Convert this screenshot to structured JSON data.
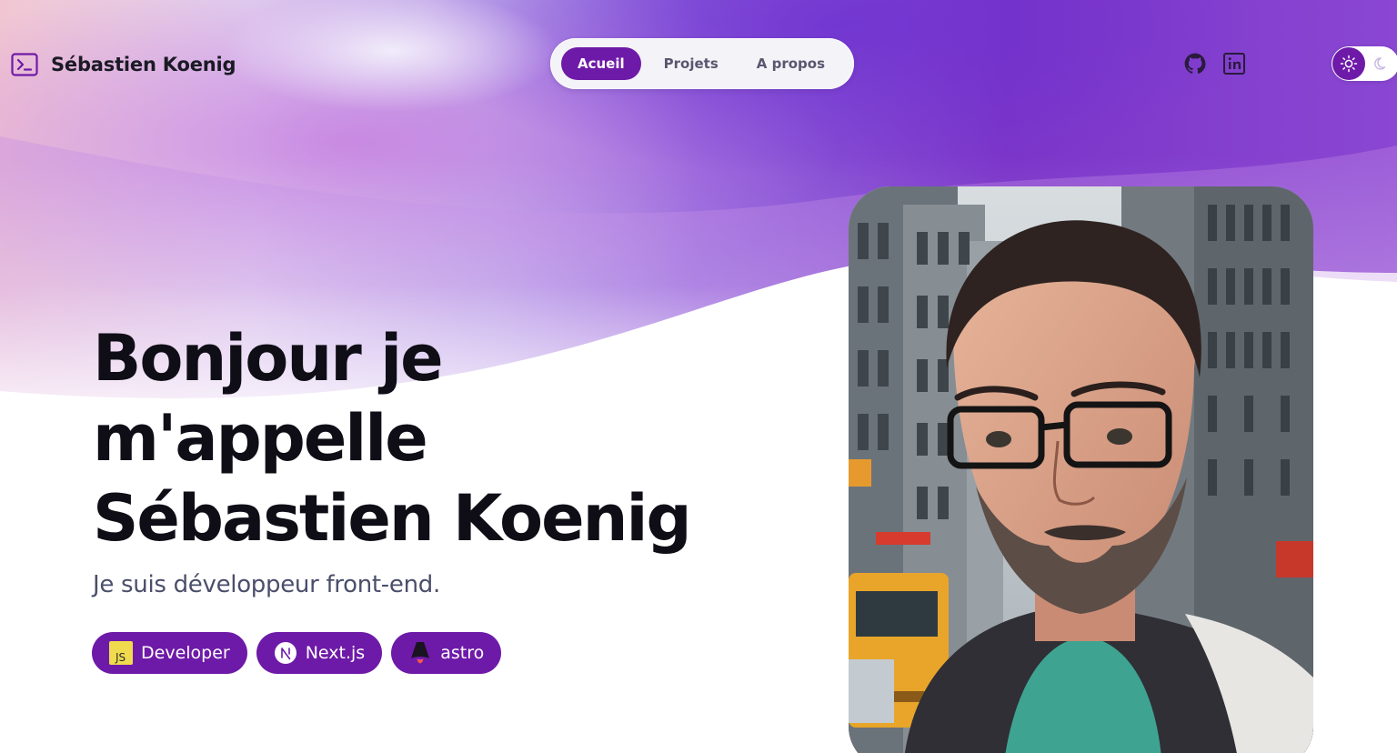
{
  "header": {
    "brand_name": "Sébastien Koenig",
    "nav": [
      {
        "label": "Acueil",
        "active": true
      },
      {
        "label": "Projets",
        "active": false
      },
      {
        "label": "A propos",
        "active": false
      }
    ],
    "social_icons": [
      "github-icon",
      "linkedin-icon"
    ],
    "theme_toggle": {
      "icons": [
        "sun-icon",
        "moon-icon"
      ],
      "selected": "light"
    }
  },
  "hero": {
    "title_lines": [
      "Bonjour je",
      "m'appelle",
      "Sébastien Koenig"
    ],
    "subtitle": "Je suis développeur front-end.",
    "badges": [
      {
        "label": "Developer",
        "icon": "javascript-icon"
      },
      {
        "label": "Next.js",
        "icon": "nextjs-icon"
      },
      {
        "label": "astro",
        "icon": "astro-icon"
      }
    ]
  },
  "portrait": {
    "icon": "illustrated-portrait-image"
  },
  "colors": {
    "accent": "#6e1aa8",
    "title": "#0f0d16",
    "subtitle": "#4b4f6b",
    "js_yellow": "#f0db4f"
  }
}
